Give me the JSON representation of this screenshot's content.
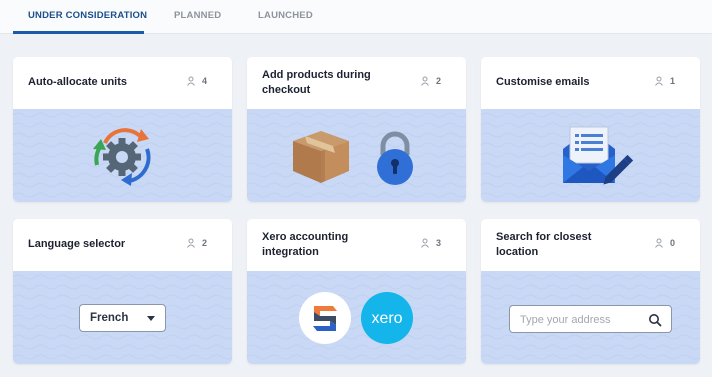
{
  "tabs": [
    {
      "label": "UNDER CONSIDERATION",
      "active": true
    },
    {
      "label": "PLANNED",
      "active": false
    },
    {
      "label": "LAUNCHED",
      "active": false
    }
  ],
  "cards": [
    {
      "title": "Auto-allocate units",
      "votes": "4",
      "illustration": "gear-sync-icon"
    },
    {
      "title": "Add products during checkout",
      "votes": "2",
      "illustration": "box-and-padlock-icons"
    },
    {
      "title": "Customise emails",
      "votes": "1",
      "illustration": "email-edit-icon"
    },
    {
      "title": "Language selector",
      "votes": "2",
      "dropdown_value": "French"
    },
    {
      "title": "Xero accounting integration",
      "votes": "3",
      "logos": [
        "s-logo-icon",
        "xero-logo-icon"
      ],
      "xero_text": "xero"
    },
    {
      "title": "Search for closest location",
      "votes": "0",
      "search_placeholder": "Type your address"
    }
  ],
  "colors": {
    "accent": "#1b5aa6",
    "card_body": "#c9d9f5",
    "xero_blue": "#13b5ea"
  }
}
